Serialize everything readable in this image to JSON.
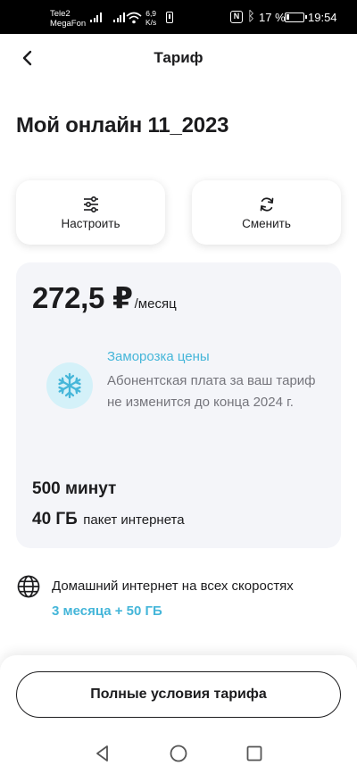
{
  "status": {
    "carrier1": "Tele2",
    "carrier2": "MegaFon",
    "speed_value": "6,9",
    "speed_unit": "K/s",
    "nfc": "N",
    "battery_pct": "17 %",
    "time": "19:54"
  },
  "header": {
    "title": "Тариф"
  },
  "plan": {
    "name": "Мой онлайн 11_2023"
  },
  "actions": {
    "configure": "Настроить",
    "change": "Сменить"
  },
  "price": {
    "amount": "272,5 ₽",
    "period": "/месяц"
  },
  "freeze": {
    "title": "Заморозка цены",
    "text": "Абонентская плата за ваш тариф не изменится до конца 2024 г."
  },
  "includes": {
    "minutes": "500 минут",
    "gb": "40 ГБ",
    "gb_desc": "пакет интернета"
  },
  "home_internet": {
    "label": "Домашний интернет на всех скоростях",
    "promo": "3 месяца + 50 ГБ"
  },
  "full_terms": "Полные условия тарифа",
  "colors": {
    "accent": "#45b6d9",
    "card_bg": "#f4f5f9",
    "freeze_bg": "#d4f1f9"
  }
}
